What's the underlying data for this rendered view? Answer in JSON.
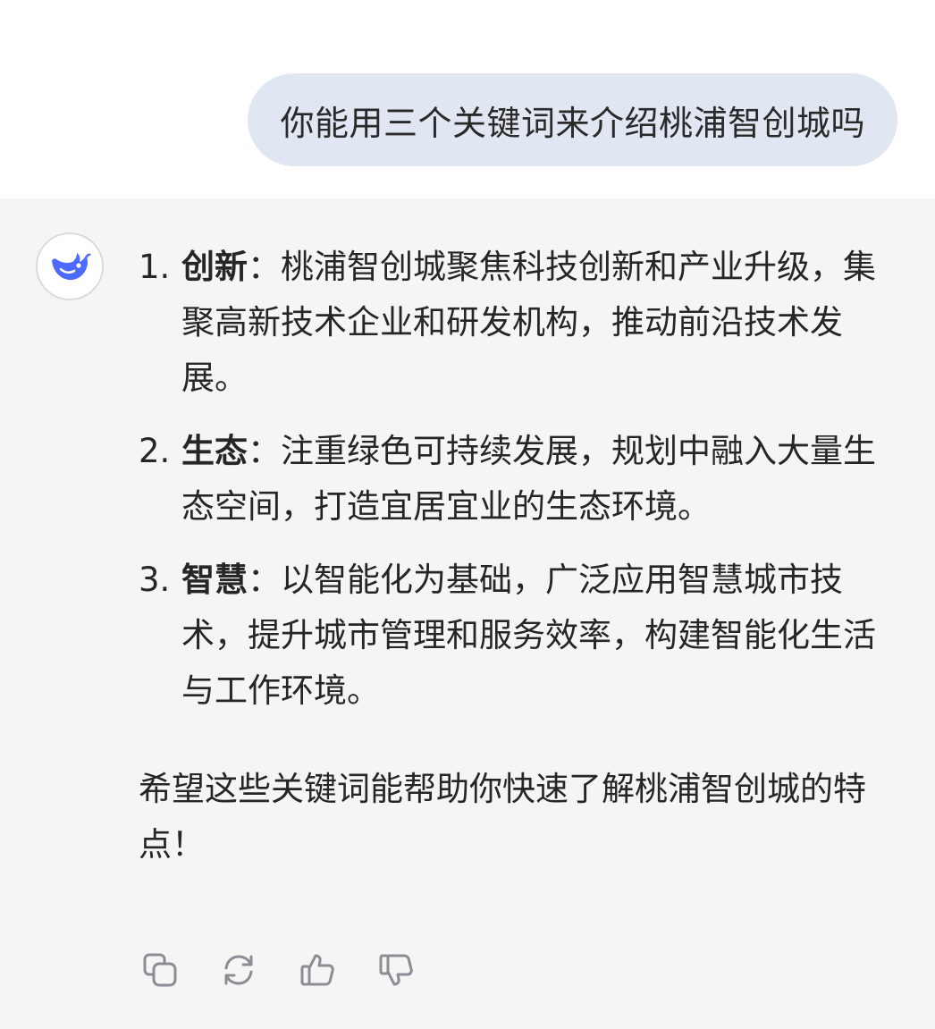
{
  "user_message": {
    "text": "你能用三个关键词来介绍桃浦智创城吗"
  },
  "assistant": {
    "avatar_icon": "deepseek-whale-icon",
    "accent_color": "#4d6bfe",
    "items": [
      {
        "number": "1.",
        "title": "创新",
        "separator": "：",
        "body": "桃浦智创城聚焦科技创新和产业升级，集聚高新技术企业和研发机构，推动前沿技术发展。"
      },
      {
        "number": "2.",
        "title": "生态",
        "separator": "：",
        "body": "注重绿色可持续发展，规划中融入大量生态空间，打造宜居宜业的生态环境。"
      },
      {
        "number": "3.",
        "title": "智慧",
        "separator": "：",
        "body": "以智能化为基础，广泛应用智慧城市技术，提升城市管理和服务效率，构建智能化生活与工作环境。"
      }
    ],
    "outro": "希望这些关键词能帮助你快速了解桃浦智创城的特点！"
  },
  "actions": {
    "icons": [
      "copy-icon",
      "regenerate-icon",
      "thumbs-up-icon",
      "thumbs-down-icon"
    ],
    "icon_color": "#8a8d93"
  }
}
